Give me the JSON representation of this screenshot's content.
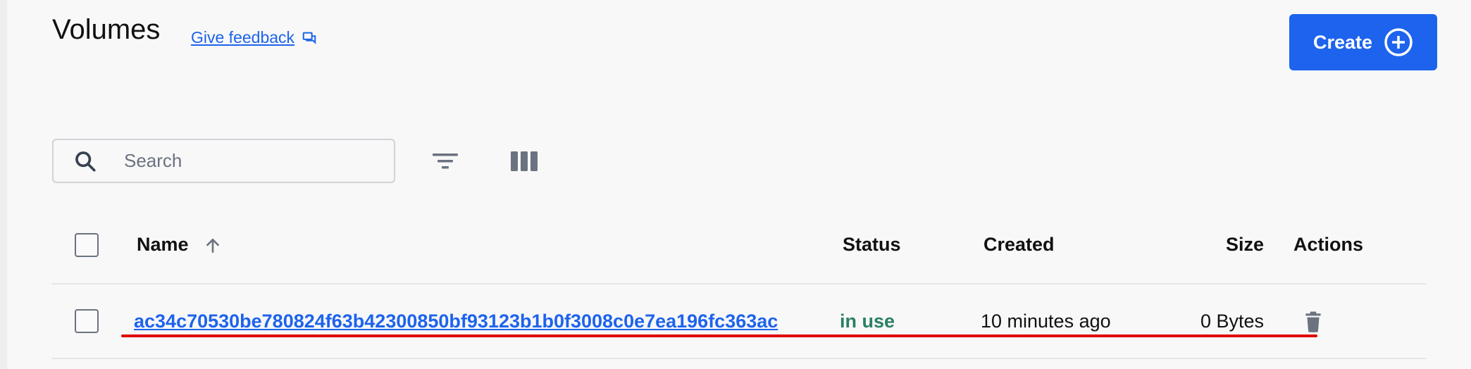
{
  "header": {
    "title": "Volumes",
    "feedback_label": "Give feedback",
    "create_label": "Create"
  },
  "search": {
    "placeholder": "Search",
    "value": ""
  },
  "table": {
    "columns": {
      "name": "Name",
      "status": "Status",
      "created": "Created",
      "size": "Size",
      "actions": "Actions"
    },
    "rows": [
      {
        "name": "ac34c70530be780824f63b42300850bf93123b1b0f3008c0e7ea196fc363ac",
        "status": "in use",
        "created": "10 minutes ago",
        "size": "0 Bytes"
      }
    ]
  },
  "colors": {
    "accent": "#1d63ed",
    "status_in_use": "#2a7f62",
    "annotation_underline": "#e00000"
  },
  "icons": [
    "feedback-icon",
    "plus-circle-icon",
    "search-icon",
    "filter-icon",
    "columns-icon",
    "sort-ascending-icon",
    "trash-icon"
  ]
}
